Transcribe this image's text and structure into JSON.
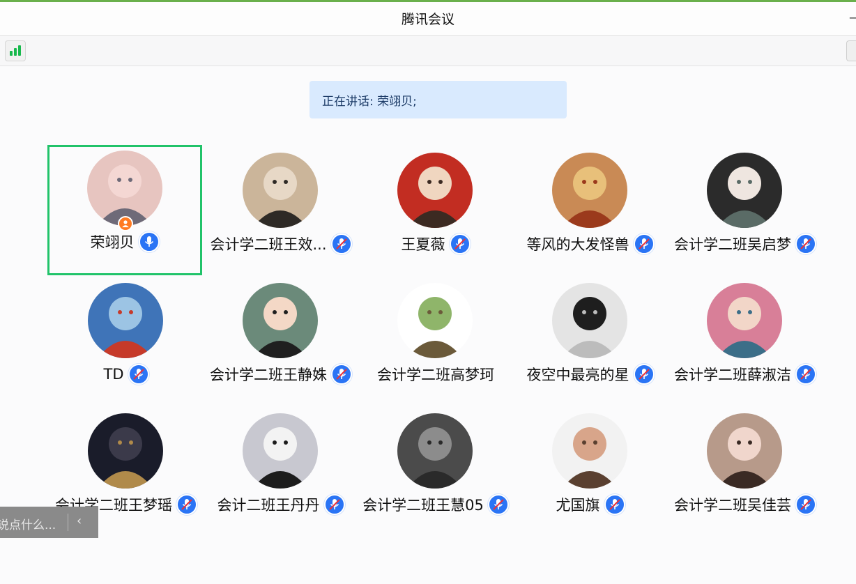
{
  "window": {
    "title": "腾讯会议"
  },
  "colors": {
    "accent": "#6ab04c",
    "speaker_border": "#21c36a",
    "mic": "#2a74f5",
    "host_badge": "#ff7a22",
    "speaking_banner": "#d9eafe"
  },
  "toolbar": {
    "signal_icon": "network-signal-icon"
  },
  "speaking": {
    "text": "正在讲话: 荣翊贝;"
  },
  "participants": [
    {
      "name": "荣翊贝",
      "mic": "on",
      "host": true,
      "active": true
    },
    {
      "name": "会计学二班王效...",
      "mic": "muted"
    },
    {
      "name": "王夏薇",
      "mic": "muted"
    },
    {
      "name": "等风的大发怪兽",
      "mic": "muted"
    },
    {
      "name": "会计学二班吴启梦",
      "mic": "muted"
    },
    {
      "name": "TD",
      "mic": "muted"
    },
    {
      "name": "会计学二班王静姝",
      "mic": "muted"
    },
    {
      "name": "会计学二班高梦珂",
      "mic": "none"
    },
    {
      "name": "夜空中最亮的星",
      "mic": "muted"
    },
    {
      "name": "会计学二班薛淑洁",
      "mic": "muted"
    },
    {
      "name": "会计学二班王梦瑶",
      "mic": "muted"
    },
    {
      "name": "会计二班王丹丹",
      "mic": "muted"
    },
    {
      "name": "会计学二班王慧05",
      "mic": "muted"
    },
    {
      "name": "尤国旗",
      "mic": "muted"
    },
    {
      "name": "会计学二班吴佳芸",
      "mic": "muted"
    }
  ],
  "chat": {
    "placeholder": "说点什么...",
    "toggle_icon": "‹"
  }
}
